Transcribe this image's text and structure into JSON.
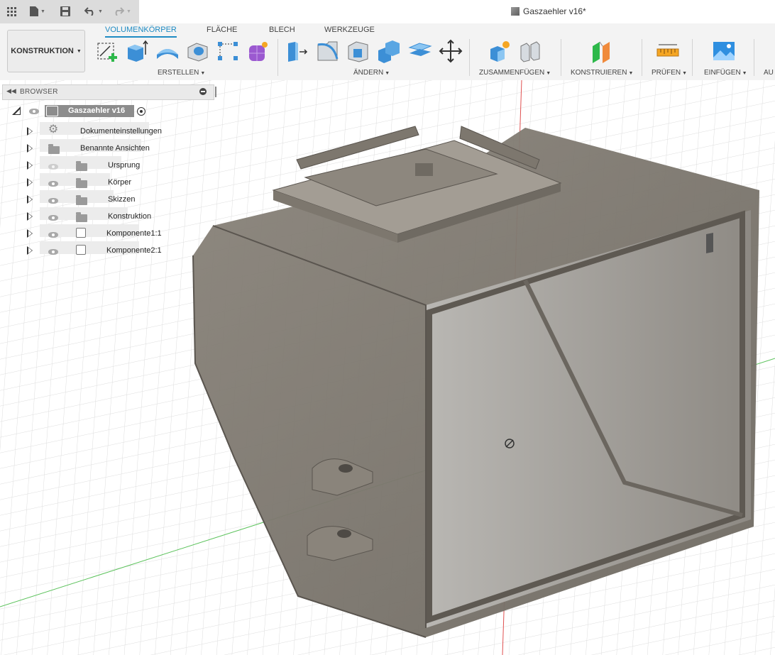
{
  "document": {
    "title": "Gaszaehler v16*"
  },
  "workspace": {
    "label": "KONSTRUKTION"
  },
  "tabs": [
    {
      "label": "VOLUMENKÖRPER",
      "active": true
    },
    {
      "label": "FLÄCHE",
      "active": false
    },
    {
      "label": "BLECH",
      "active": false
    },
    {
      "label": "WERKZEUGE",
      "active": false
    }
  ],
  "groups": [
    {
      "label": "ERSTELLEN"
    },
    {
      "label": "ÄNDERN"
    },
    {
      "label": "ZUSAMMENFÜGEN"
    },
    {
      "label": "KONSTRUIEREN"
    },
    {
      "label": "PRÜFEN"
    },
    {
      "label": "EINFÜGEN"
    },
    {
      "label": "AU"
    }
  ],
  "tools": [
    "sketch-create-icon",
    "extrude-icon",
    "revolve-icon",
    "hole-icon",
    "pattern-icon",
    "form-icon",
    "press-pull-icon",
    "fillet-icon",
    "shell-icon",
    "combine-icon",
    "offset-plane-icon",
    "move-icon",
    "new-component-icon",
    "joint-icon",
    "construct-plane-icon",
    "measure-icon",
    "insert-image-icon"
  ],
  "browser": {
    "header": "BROWSER",
    "root": {
      "label": "Gaszaehler v16"
    },
    "items": [
      {
        "label": "Dokumenteinstellungen",
        "icon": "gear-icon",
        "visible": null
      },
      {
        "label": "Benannte Ansichten",
        "icon": "folder-icon",
        "visible": null
      },
      {
        "label": "Ursprung",
        "icon": "folder-icon",
        "visible": false
      },
      {
        "label": "Körper",
        "icon": "folder-icon",
        "visible": true
      },
      {
        "label": "Skizzen",
        "icon": "folder-icon",
        "visible": true
      },
      {
        "label": "Konstruktion",
        "icon": "folder-icon",
        "visible": true
      },
      {
        "label": "Komponente1:1",
        "icon": "component-icon",
        "visible": true
      },
      {
        "label": "Komponente2:1",
        "icon": "component-icon",
        "visible": true
      }
    ]
  },
  "colors": {
    "accent": "#1e8bc3",
    "model": "#7d776e",
    "axis_red": "#e05050",
    "axis_green": "#5bc25b"
  }
}
